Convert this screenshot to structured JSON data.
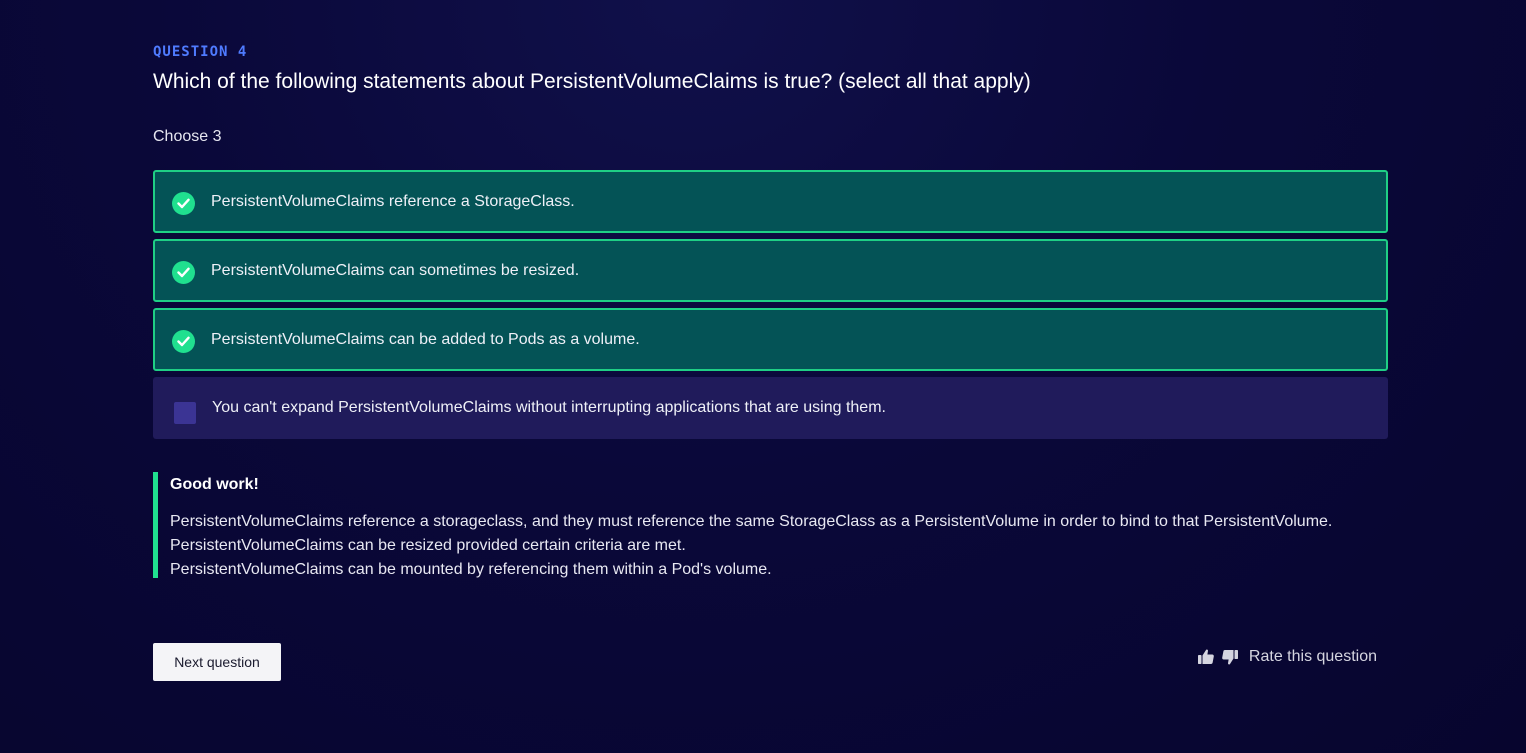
{
  "question": {
    "label": "QUESTION 4",
    "title": "Which of the following statements about PersistentVolumeClaims is true? (select all that apply)",
    "instruction": "Choose 3"
  },
  "options": [
    {
      "text": "PersistentVolumeClaims reference a StorageClass.",
      "state": "correct",
      "icon": "check-circle-icon"
    },
    {
      "text": "PersistentVolumeClaims can sometimes be resized.",
      "state": "correct",
      "icon": "check-circle-icon"
    },
    {
      "text": "PersistentVolumeClaims can be added to Pods as a volume.",
      "state": "correct",
      "icon": "check-circle-icon"
    },
    {
      "text": "You can't expand PersistentVolumeClaims without interrupting applications that are using them.",
      "state": "unselected",
      "icon": "checkbox-empty-icon"
    }
  ],
  "feedback": {
    "title": "Good work!",
    "lines": [
      "PersistentVolumeClaims reference a storageclass, and they must reference the same StorageClass as a PersistentVolume in order to bind to that PersistentVolume.",
      "PersistentVolumeClaims can be resized provided certain criteria are met.",
      "PersistentVolumeClaims can be mounted by referencing them within a Pod's volume."
    ]
  },
  "actions": {
    "next_label": "Next question",
    "rate_label": "Rate this question",
    "thumb_up_icon": "thumbs-up-icon",
    "thumb_down_icon": "thumbs-down-icon"
  },
  "colors": {
    "accent_blue": "#4f7bff",
    "correct_green": "#20e08f",
    "correct_bg": "#045356",
    "option_bg": "#201b5b",
    "page_bg": "#0a0839"
  }
}
